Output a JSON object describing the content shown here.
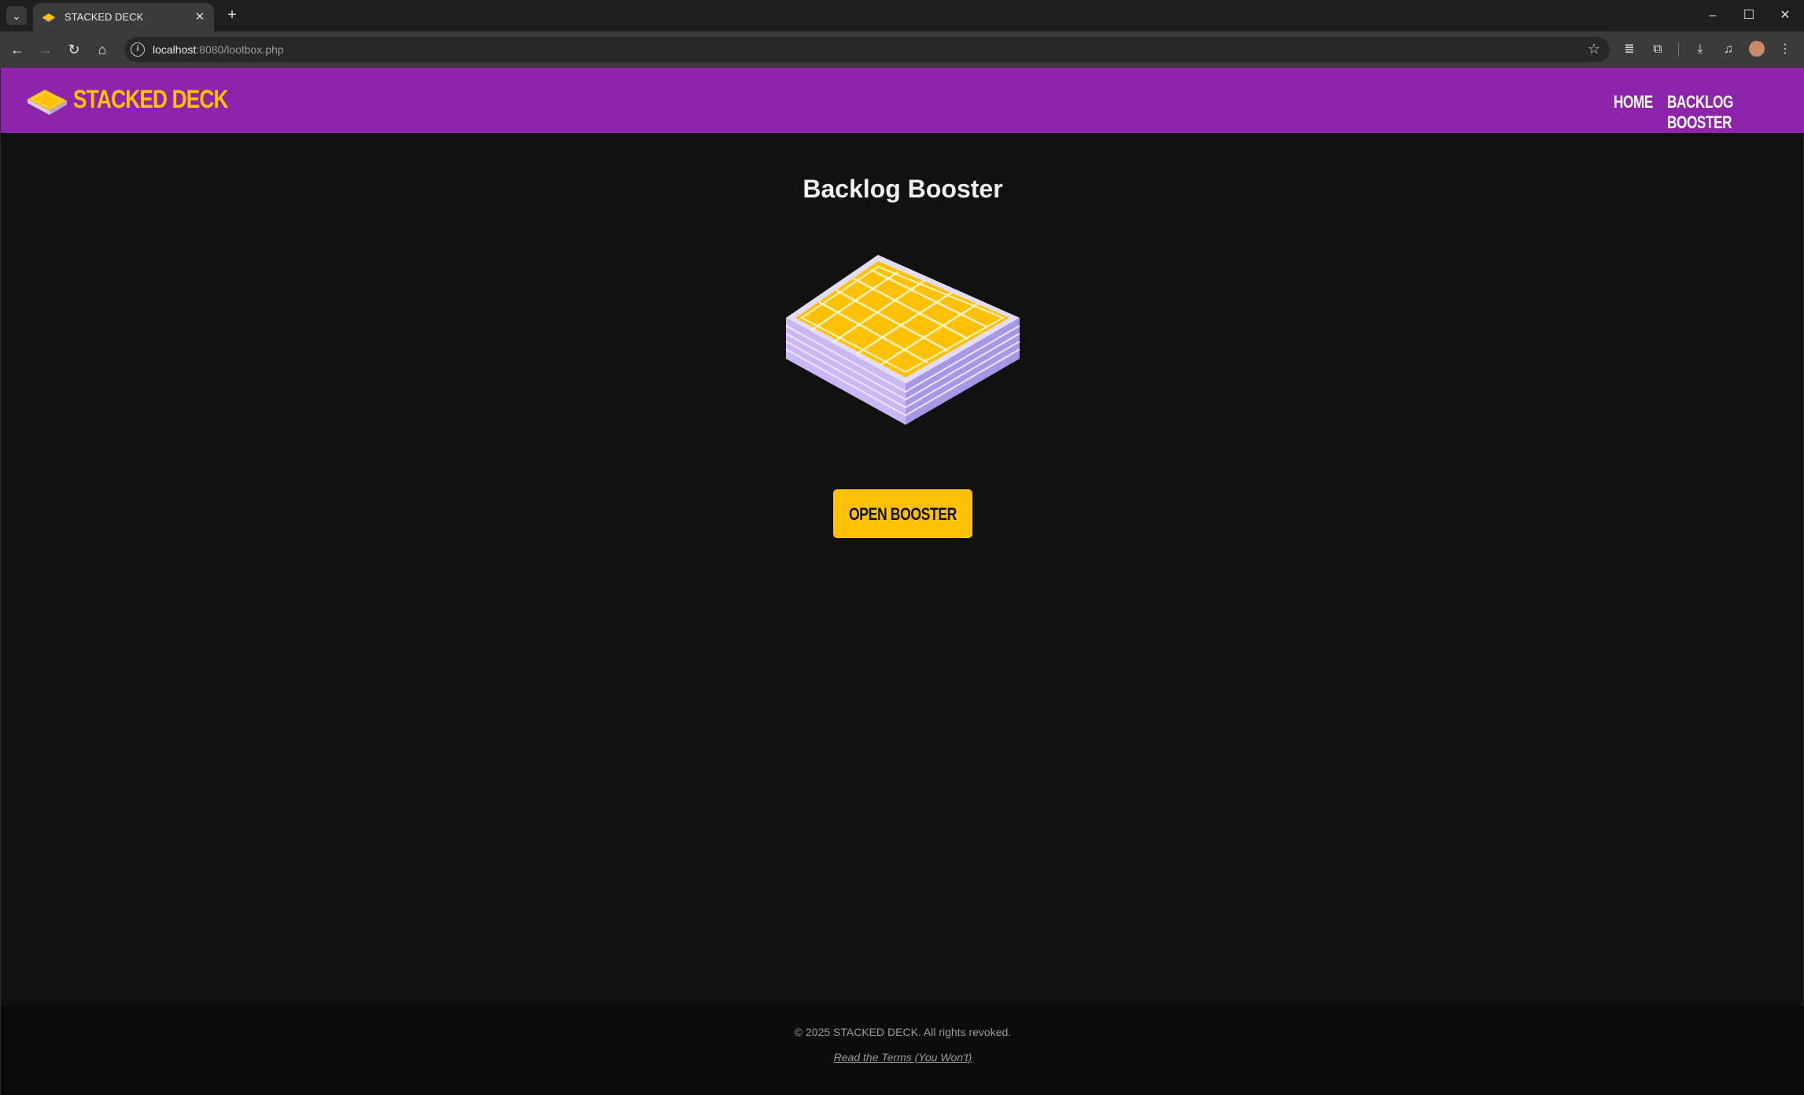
{
  "browser": {
    "tab_title": "STACKED DECK",
    "url_host": "localhost",
    "url_path": ":8080/lootbox.php"
  },
  "site": {
    "brand": "STACKED DECK",
    "nav": [
      {
        "label": "HOME"
      },
      {
        "label": "BACKLOG BOOSTER"
      }
    ],
    "colors": {
      "header_bg": "#8e24aa",
      "accent": "#ffc107",
      "page_bg": "#111111"
    }
  },
  "main": {
    "title": "Backlog Booster",
    "open_button_label": "OPEN BOOSTER"
  },
  "footer": {
    "copyright": "© 2025 STACKED DECK. All rights revoked.",
    "terms_link": "Read the Terms (You Won't)"
  }
}
